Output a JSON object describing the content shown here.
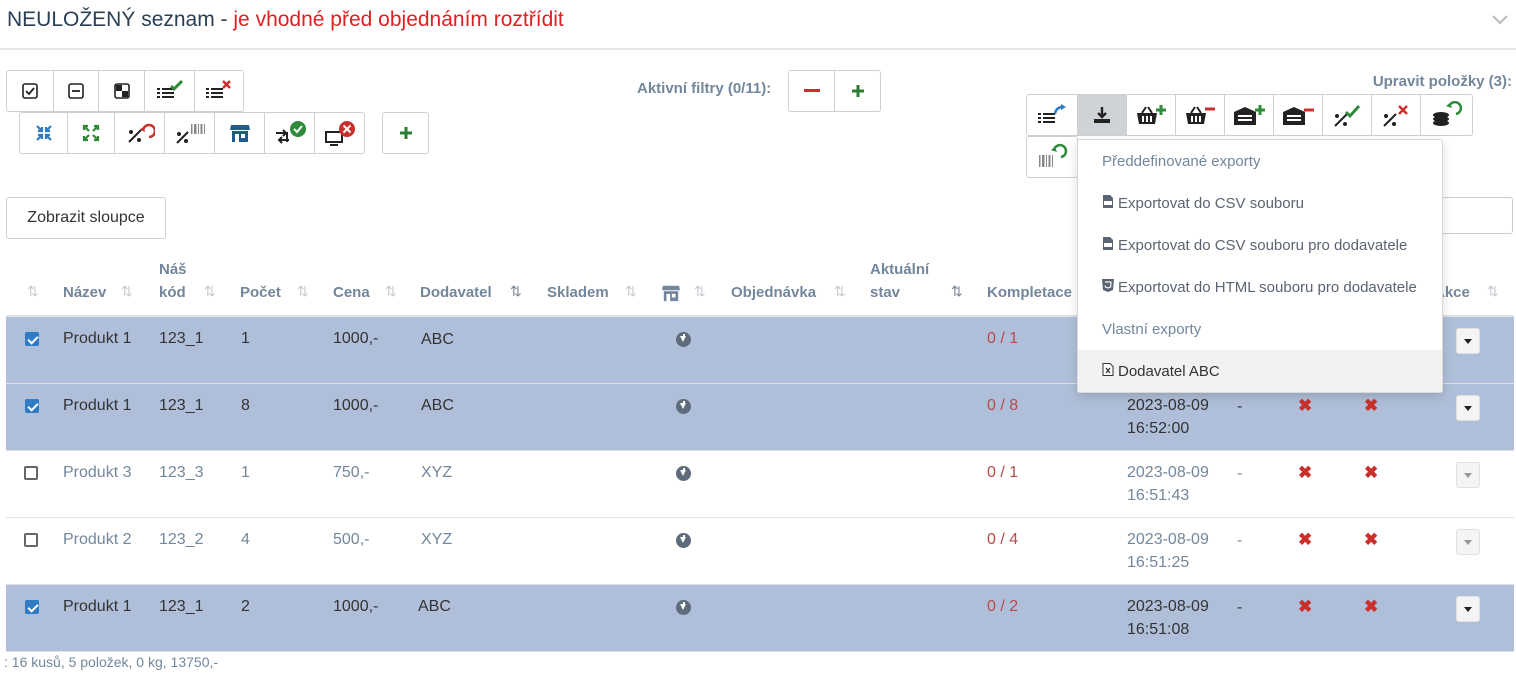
{
  "header": {
    "title_main": "NEULOŽENÝ seznam - ",
    "title_warning": "je vhodné před objednáním roztřídit"
  },
  "toolbar": {
    "filters_label": "Aktivní filtry (0/11):",
    "edit_label": "Upravit položky (3):"
  },
  "show_columns_label": "Zobrazit sloupce",
  "columns": {
    "nazev": "Název",
    "nas_kod_1": "Náš",
    "nas_kod_2": "kód",
    "pocet": "Počet",
    "cena": "Cena",
    "dodavatel": "Dodavatel",
    "skladem": "Skladem",
    "objednavka": "Objednávka",
    "aktualni_1": "Aktuální",
    "aktualni_2": "stav",
    "kompletace": "Kompletace",
    "akce": "Akce"
  },
  "rows": [
    {
      "selected": true,
      "name": "Produkt 1",
      "code": "123_1",
      "count": "1",
      "price": "1000,-",
      "supplier": "ABC",
      "completion": "0 / 1",
      "date": "",
      "time": "",
      "dash": "",
      "x1": "",
      "x2": ""
    },
    {
      "selected": true,
      "name": "Produkt 1",
      "code": "123_1",
      "count": "8",
      "price": "1000,-",
      "supplier": "ABC",
      "completion": "0 / 8",
      "date": "2023-08-09",
      "time": "16:52:00",
      "dash": "-",
      "x1": "✖",
      "x2": "✖"
    },
    {
      "selected": false,
      "name": "Produkt 3",
      "code": "123_3",
      "count": "1",
      "price": "750,-",
      "supplier": "XYZ",
      "completion": "0 / 1",
      "date": "2023-08-09",
      "time": "16:51:43",
      "dash": "-",
      "x1": "✖",
      "x2": "✖"
    },
    {
      "selected": false,
      "name": "Produkt 2",
      "code": "123_2",
      "count": "4",
      "price": "500,-",
      "supplier": "XYZ",
      "completion": "0 / 4",
      "date": "2023-08-09",
      "time": "16:51:25",
      "dash": "-",
      "x1": "✖",
      "x2": "✖"
    },
    {
      "selected": true,
      "name": "Produkt 1",
      "code": "123_1",
      "count": "2",
      "price": "1000,-",
      "supplier": "ABC",
      "completion": "0 / 2",
      "date": "2023-08-09",
      "time": "16:51:08",
      "dash": "-",
      "x1": "✖",
      "x2": "✖"
    }
  ],
  "footer": ": 16 kusů, 5 položek, 0 kg, 13750,-",
  "export_menu": {
    "predefined_header": "Předdefinované exporty",
    "csv": "Exportovat do CSV souboru",
    "csv_supplier": "Exportovat do CSV souboru pro dodavatele",
    "html_supplier": "Exportovat do HTML souboru pro dodavatele",
    "custom_header": "Vlastní exporty",
    "custom_abc": "Dodavatel ABC"
  },
  "colors": {
    "accent_blue": "#2f7cc4",
    "selected_row": "#b0bfd9",
    "green": "#2e8b3a",
    "red": "#c9302c"
  }
}
